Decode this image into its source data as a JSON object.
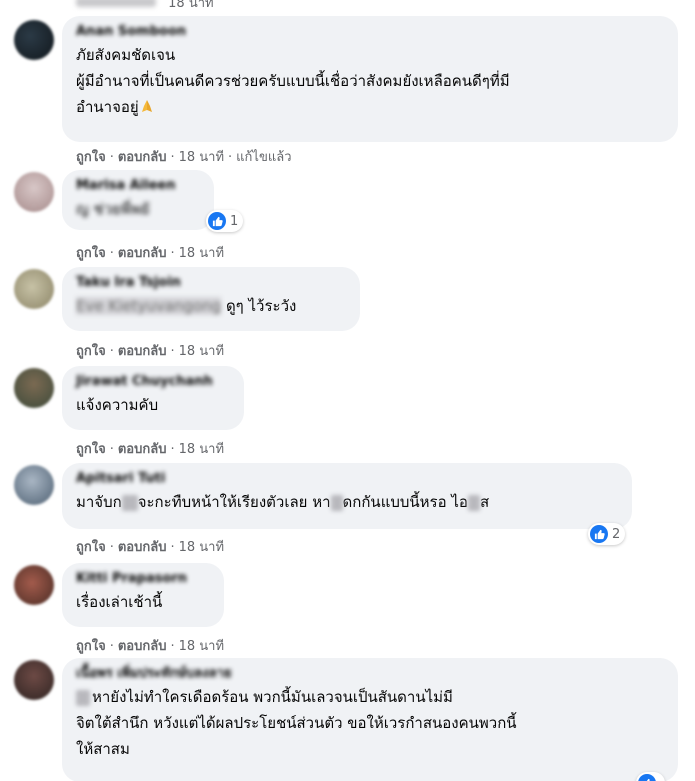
{
  "comments": [
    {
      "author": "Anan Somboon",
      "lines": [
        "ภัยสังคมชัดเจน",
        "ผู้มีอำนาจที่เป็นคนดีควรช่วยครับแบบนี้เชื่อว่าสังคมยังเหลือคนดีๆที่มี",
        "อำนาจอยู่"
      ],
      "emoji": "praying-hands",
      "like_label": "ถูกใจ",
      "reply_label": "ตอบกลับ",
      "time": "18 นาที",
      "edited": "แก้ไขแล้ว"
    },
    {
      "author": "Marisa Aileen",
      "lines": [
        "ญ ช่วยพี่พยั"
      ],
      "like_label": "ถูกใจ",
      "reply_label": "ตอบกลับ",
      "time": "18 นาที",
      "reaction_count": "1"
    },
    {
      "author": "Taku Ira Tsjoin",
      "mention": "Eve Kietyuvangong",
      "lines": [
        "ดูๆ ไว้ระวัง"
      ],
      "like_label": "ถูกใจ",
      "reply_label": "ตอบกลับ",
      "time": "18 นาที"
    },
    {
      "author": "Jirawat Chuychanh",
      "lines": [
        "แจ้งความคับ"
      ],
      "like_label": "ถูกใจ",
      "reply_label": "ตอบกลับ",
      "time": "18 นาที"
    },
    {
      "author": "Apitsari Tuti",
      "line_parts": [
        "มาจับก",
        "จะกะทืบหน้าให้เรียงตัวเลย หา",
        "ดกกันแบบนี้หรอ ไอ",
        "ส"
      ],
      "like_label": "ถูกใจ",
      "reply_label": "ตอบกลับ",
      "time": "18 นาที",
      "reaction_count": "2"
    },
    {
      "author": "Kitti Prapasorn",
      "lines": [
        "เรื่องเล่าเช้านี้"
      ],
      "like_label": "ถูกใจ",
      "reply_label": "ตอบกลับ",
      "time": "18 นาที"
    },
    {
      "author": "เนื้อพร เพิ่มประทักษ์บลงลาย",
      "lines": [
        "หายังไม่ทำใครเดือดร้อน พวกนี้มันเลวจนเป็นสันดานไม่มี",
        "จิตใต้สำนึก หวังแต่ได้ผลประโยชน์ส่วนตัว ขอให้เวรกำสนองคนพวกนี้",
        "ให้สาสม"
      ],
      "reaction_count": ""
    }
  ],
  "top_time": "18 นาที",
  "colors": {
    "accent": "#1877f2",
    "bubble": "#f0f2f5",
    "meta": "#65676b"
  }
}
